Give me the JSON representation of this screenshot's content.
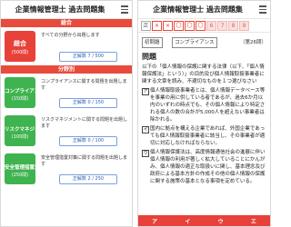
{
  "app_title": "企業情報管理士 過去問題集",
  "left": {
    "section_general": "総合",
    "general": {
      "name": "総合",
      "count": "(500問)",
      "desc": "すべての分野から出題します",
      "progress": "正解数 7 / 500"
    },
    "section_field": "分野別",
    "fields": [
      {
        "name": "コンプライアンス",
        "count": "(150問)",
        "desc": "コンプライアンスに関する問題を出題します",
        "progress": "正解数 0 / 150"
      },
      {
        "name": "リスクマネジメント",
        "count": "(100問)",
        "desc": "リスクマネジメントに関する問題を出題します",
        "progress": "正解数 0 / 100"
      },
      {
        "name": "安全管理措置対策",
        "count": "(250問)",
        "desc": "安全管理措置対策に関する問題を出題します",
        "progress": "正解数 2 / 250"
      }
    ]
  },
  "right": {
    "status": [
      "正",
      "✕",
      "✕",
      "〇",
      "〇",
      "〇",
      "6",
      "7",
      "8",
      "9"
    ],
    "tag_year": "初問題",
    "tag_category": "コンプライアンス",
    "question_number": "〔第26問〕",
    "heading": "問題",
    "question": "以下の「個人情報の保護に関する法律（以下、「個人情報保護法」という）」の目的及び個人情報取扱事業者に関する文章を読み、不適切なものを１つ選びなさい",
    "choices": [
      {
        "key": "ア",
        "text": "個人情報取扱事業者とは、個人情報データベース等を事業の用に供している者であるが、過去6か月以内のいずれの時点でも、その個人情報により特定される個人の数の合計が5,000人を超えない事業者は除かれる。"
      },
      {
        "key": "イ",
        "text": "国内に拠点を構える企業であれば、外国企業であっても個人情報取扱事業者に該当し、その事業者が適切に対応しなければならない。"
      },
      {
        "key": "ウ",
        "text": "個人情報保護法は、高度情報通信社会の進展に伴い個人情報の利用が著しく拡大していることにかんがみ、個人情報の適正な取扱いに関し、基本理念及び政府による基本方針の作成その他の個人情報の保護に関する施策の基本となる事項を定めている。"
      }
    ],
    "answer_keys": [
      "ア",
      "イ",
      "ウ",
      "エ"
    ]
  }
}
